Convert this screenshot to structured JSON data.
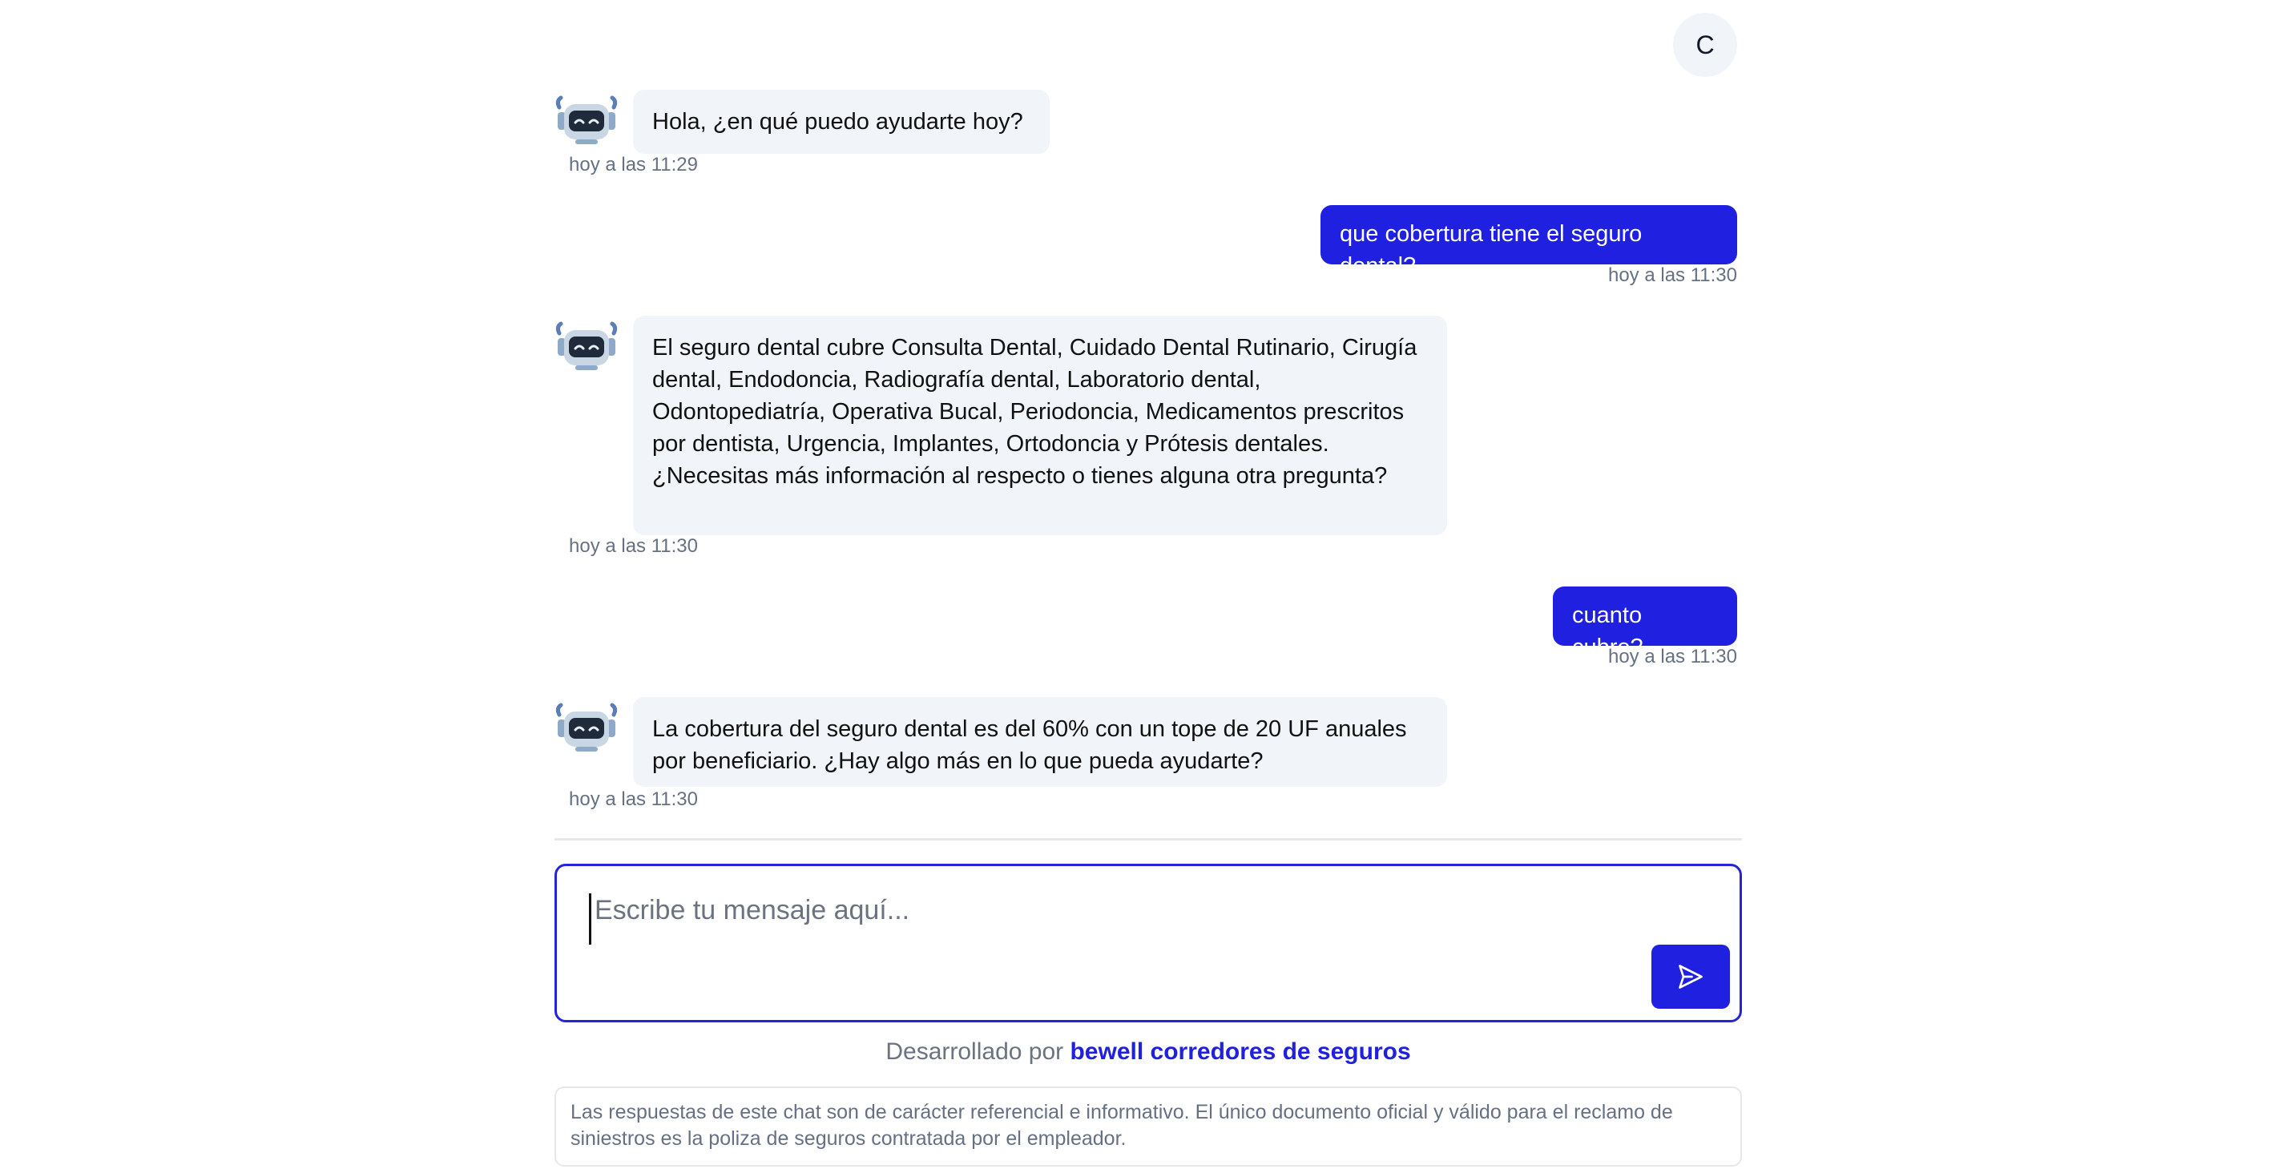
{
  "user": {
    "avatar_initial": "C"
  },
  "messages": [
    {
      "role": "bot",
      "text": "Hola, ¿en qué puedo ayudarte hoy?",
      "time": "hoy a las 11:29"
    },
    {
      "role": "user",
      "text": "que cobertura tiene el seguro dental?",
      "time": "hoy a las 11:30"
    },
    {
      "role": "bot",
      "text": "El seguro dental cubre Consulta Dental, Cuidado Dental Rutinario, Cirugía dental, Endodoncia, Radiografía dental, Laboratorio dental, Odontopediatría, Operativa Bucal, Periodoncia, Medicamentos prescritos por dentista, Urgencia, Implantes, Ortodoncia y Prótesis dentales. ¿Necesitas más información al respecto o tienes alguna otra pregunta?",
      "time": "hoy a las 11:30"
    },
    {
      "role": "user",
      "text": "cuanto cubre?",
      "time": "hoy a las 11:30"
    },
    {
      "role": "bot",
      "text": "La cobertura del seguro dental es del 60% con un tope de 20 UF anuales por beneficiario. ¿Hay algo más en lo que pueda ayudarte?",
      "time": "hoy a las 11:30"
    }
  ],
  "composer": {
    "placeholder": "Escribe tu mensaje aquí...",
    "send_icon": "send-icon"
  },
  "footer": {
    "credit_prefix": "Desarrollado por",
    "credit_link": "bewell corredores de seguros",
    "disclaimer": "Las respuestas de este chat son de carácter referencial e informativo. El único documento oficial y válido para el reclamo de siniestros es la poliza de seguros contratada por el empleador."
  },
  "colors": {
    "accent": "#2020e0",
    "bot_bubble": "#f1f4f8",
    "timestamp": "#667085"
  }
}
